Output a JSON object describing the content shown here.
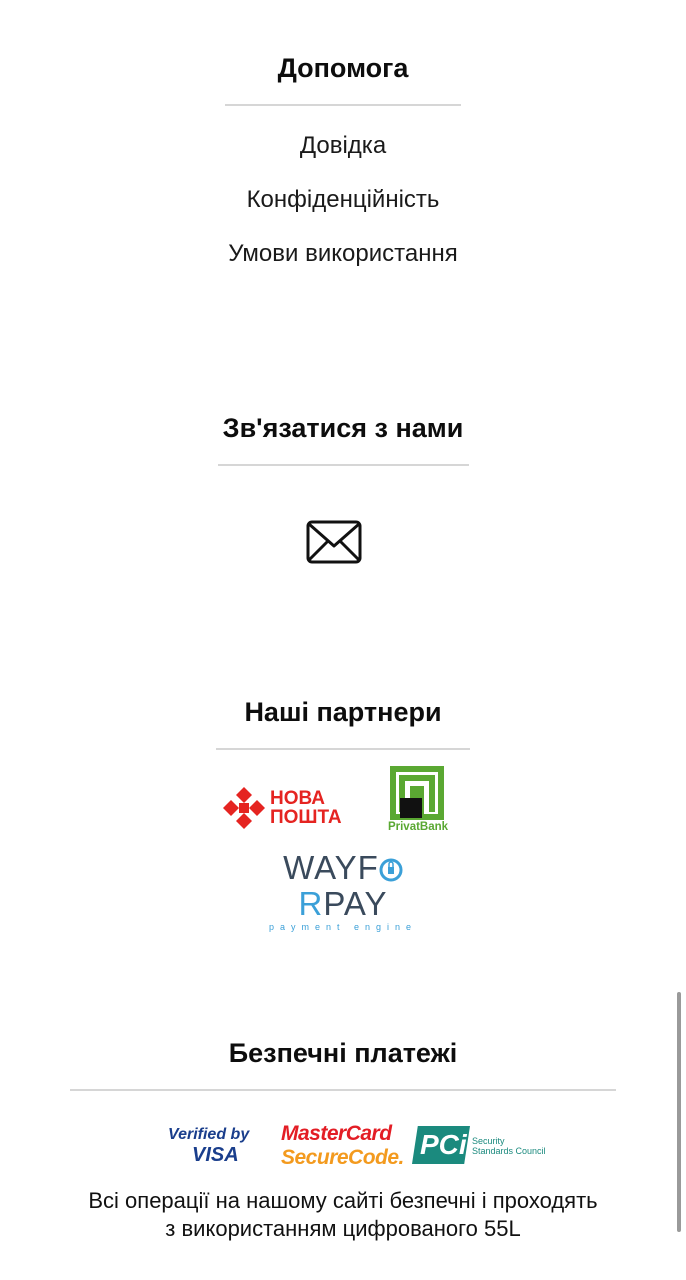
{
  "help": {
    "title": "Допомога",
    "links": [
      "Довідка",
      "Конфіденційність",
      "Умови використання"
    ]
  },
  "contact": {
    "title": "Зв'язатися з нами",
    "icon": "envelope-icon"
  },
  "partners": {
    "title": "Наші партнери",
    "nova_poshta": {
      "line1": "НОВА",
      "line2": "ПОШТА",
      "color": "#e52421"
    },
    "privatbank": {
      "label": "PrivatBank",
      "color": "#5aa832"
    },
    "wayforpay": {
      "name_part1": "WAYF",
      "name_part2": "R",
      "name_part3": "PAY",
      "tagline": "payment engine",
      "dark": "#3a4a5c",
      "light": "#3ba0d8"
    }
  },
  "secure": {
    "title": "Безпечні платежі",
    "verified_visa": {
      "line1": "Verified by",
      "line2": "VISA"
    },
    "mastercard": {
      "line1": "MasterCard",
      "line2": "SecureCode."
    },
    "pci": {
      "mark": "PCi",
      "line1": "Security",
      "line2": "Standards Council"
    },
    "text_line1": "Всі операції на нашому сайті безпечні і проходять",
    "text_line2": "з використанням цифрованого 55L"
  }
}
